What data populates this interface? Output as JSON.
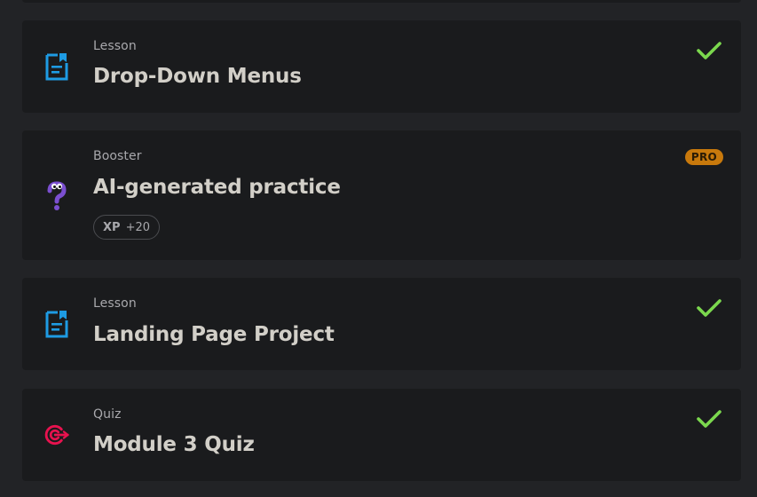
{
  "items": [
    {
      "type_label": "Lesson",
      "title": "Drop-Down Menus",
      "icon": "lesson-icon",
      "completed": true
    },
    {
      "type_label": "Booster",
      "title": "AI-generated practice",
      "icon": "booster-question-icon",
      "badge": "PRO",
      "xp_label": "XP",
      "xp_value": "+20"
    },
    {
      "type_label": "Lesson",
      "title": "Landing Page Project",
      "icon": "lesson-icon",
      "completed": true
    },
    {
      "type_label": "Quiz",
      "title": "Module 3 Quiz",
      "icon": "quiz-target-icon",
      "completed": true
    }
  ],
  "colors": {
    "background": "#222326",
    "card": "#1a1b1d",
    "lesson_icon": "#1e9be3",
    "quiz_icon": "#e8124f",
    "booster_icon": "#7b4fd0",
    "check": "#7bd84e",
    "pro_badge": "#c8790c"
  }
}
